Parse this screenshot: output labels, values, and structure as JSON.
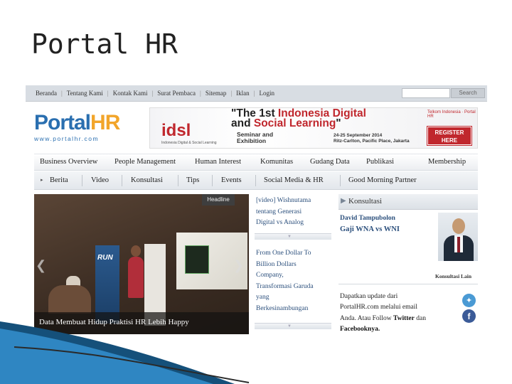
{
  "slide": {
    "title": "Portal HR"
  },
  "topnav": {
    "links": [
      "Beranda",
      "Tentang Kami",
      "Kontak Kami",
      "Surat Pembaca",
      "Sitemap",
      "Iklan",
      "Login"
    ],
    "search_placeholder": "",
    "search_button": "Search"
  },
  "header": {
    "logo_name_a": "Portal",
    "logo_name_b": "HR",
    "logo_url": "www.portalhr.com",
    "banner": {
      "brand": "idsl",
      "brand_sub": "Indonesia Digital & Social Learning",
      "headline_1_a": "\"The 1st ",
      "headline_1_b": "Indonesia Digital",
      "headline_2_a": "and ",
      "headline_2_b": "Social Learning",
      "headline_2_c": "\"",
      "sub_1": "Seminar and",
      "sub_2": "Exhibition",
      "date_1": "24-25 September 2014",
      "date_2": "Ritz-Carlton, Pacific Place, Jakarta",
      "partner": "Telkom Indonesia · Portal HR",
      "register_1": "REGISTER",
      "register_2": "HERE"
    }
  },
  "main_menu": [
    "Business Overview",
    "People Management",
    "Human Interest",
    "Komunitas",
    "Gudang Data",
    "Publikasi",
    "Membership"
  ],
  "sub_menu": [
    "Berita",
    "Video",
    "Konsultasi",
    "Tips",
    "Events",
    "Social Media & HR",
    "Good Morning Partner"
  ],
  "headline": {
    "tag": "Headline",
    "caption": "Data Membuat Hidup Praktisi HR Lebih Happy",
    "stand_text": "RUN"
  },
  "news": [
    {
      "lines": [
        "[video] Wishnutama",
        "tentang Generasi",
        "Digital vs Analog"
      ]
    },
    {
      "lines": [
        "From One Dollar To",
        "Billion Dollars",
        "Company,",
        "Transformasi Garuda",
        "yang",
        "Berkesinambungan"
      ]
    }
  ],
  "konsultasi": {
    "label": "Konsultasi",
    "author": "David Tampubolon",
    "title": "Gaji WNA vs WNI",
    "more": "Konsultasi Lain",
    "update_1": "Dapatkan update dari",
    "update_2": "PortalHR.com melalui email",
    "update_3": "Anda. Atau Follow ",
    "update_3b": "Twitter",
    "update_3c": " dan",
    "update_4": "Facebooknya."
  },
  "colors": {
    "brand_blue": "#2a6fb0",
    "brand_orange": "#f2a52a",
    "link_blue": "#2b4f7c",
    "banner_red": "#c0272d"
  },
  "icons": {
    "twitter": "twitter-icon",
    "facebook": "facebook-icon"
  }
}
